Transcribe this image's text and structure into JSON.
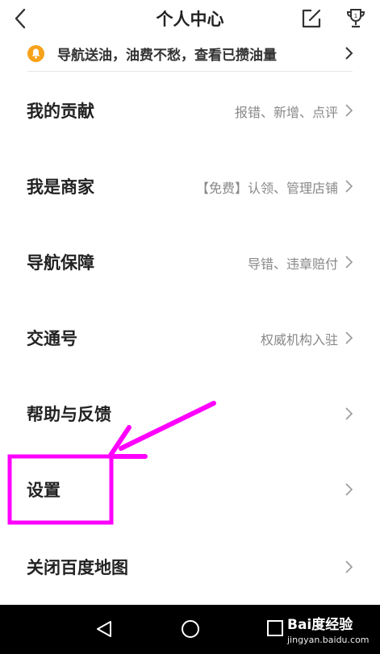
{
  "header": {
    "title": "个人中心",
    "back_icon": "chevron-left-icon",
    "edit_icon": "edit-icon",
    "trophy_icon": "trophy-icon"
  },
  "promo": {
    "text": "导航送油，油费不愁，查看已攒油量",
    "icon": "bell-icon",
    "icon_color": "#f7a21b"
  },
  "menu": {
    "items": [
      {
        "label": "我的贡献",
        "sub": "报错、新增、点评"
      },
      {
        "label": "我是商家",
        "sub": "【免费】认领、管理店铺"
      },
      {
        "label": "导航保障",
        "sub": "导错、违章赔付"
      },
      {
        "label": "交通号",
        "sub": "权威机构入驻"
      },
      {
        "label": "帮助与反馈",
        "sub": ""
      },
      {
        "label": "设置",
        "sub": ""
      },
      {
        "label": "关闭百度地图",
        "sub": ""
      }
    ]
  },
  "annotation": {
    "color": "#ff00ff",
    "highlighted_item": "设置"
  },
  "navbar": {
    "back_icon": "triangle-back-icon",
    "home_icon": "circle-home-icon",
    "recent_icon": "square-recent-icon"
  },
  "watermark": {
    "main": "Bai度经验",
    "url": "jingyan.baidu.com"
  }
}
